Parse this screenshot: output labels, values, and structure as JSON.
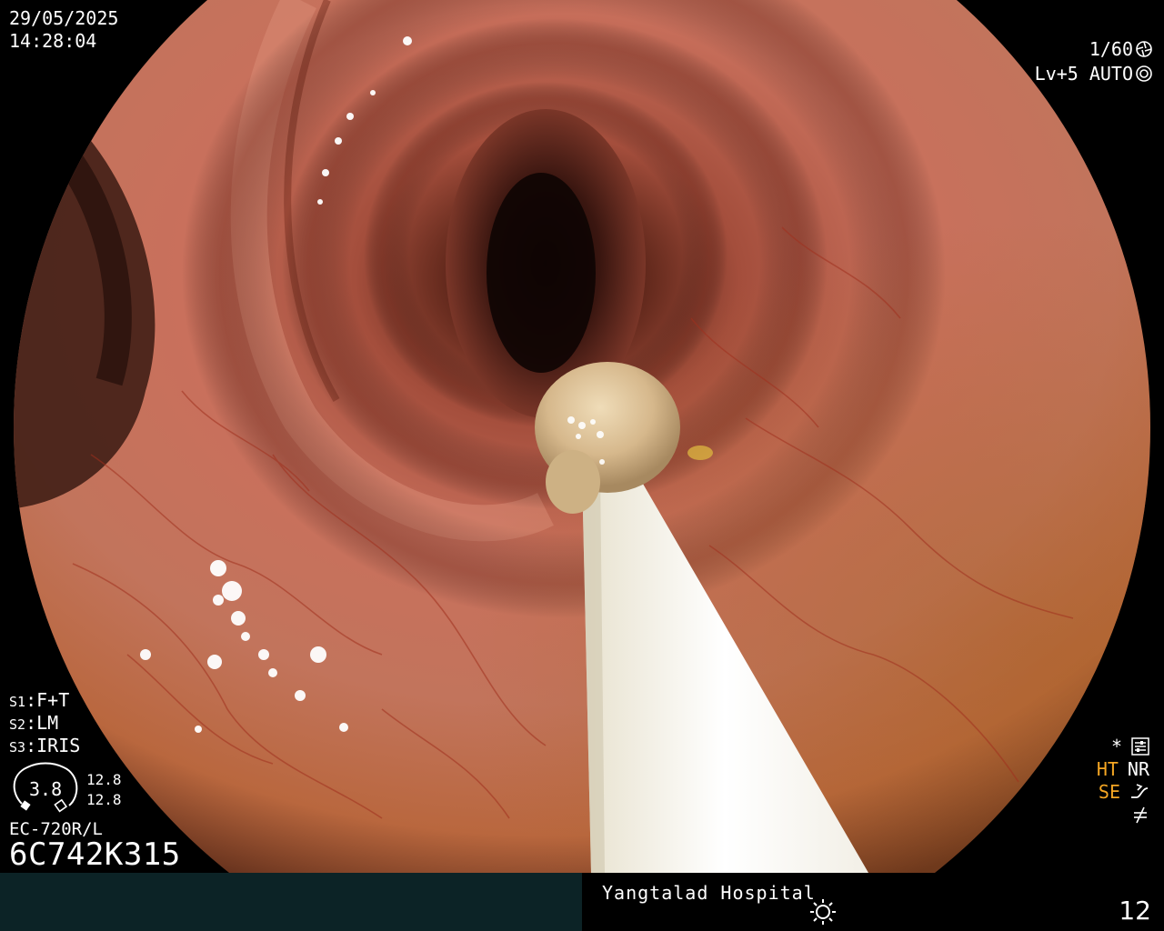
{
  "header": {
    "date": "29/05/2025",
    "time": "14:28:04",
    "shutter_speed": "1/60",
    "shutter_icon": "aperture-icon",
    "light_level": "Lv+5",
    "exposure_mode": "AUTO",
    "exposure_icon": "camera-lens-icon"
  },
  "settings": [
    {
      "key": "S1",
      "sep": ":",
      "value": "F+T"
    },
    {
      "key": "S2",
      "sep": ":",
      "value": "LM"
    },
    {
      "key": "S3",
      "sep": ":",
      "value": "IRIS"
    }
  ],
  "lens": {
    "center_value": "3.8",
    "value_top": "12.8",
    "value_bottom": "12.8"
  },
  "scope": {
    "model": "EC-720R/L",
    "serial": "6C742K315"
  },
  "status_right": {
    "asterisk": "*",
    "menu_icon": "settings-panel-icon",
    "ht": "HT",
    "nr": "NR",
    "se": "SE",
    "se_icon": "curve-arrow-icon",
    "filter_icon": "not-equal-icon"
  },
  "footer": {
    "hospital": "Yangtalad Hospital",
    "brightness_icon": "sun-icon",
    "image_count": "12"
  },
  "colors": {
    "highlight": "#f5a623",
    "footer_bg": "#0c2326",
    "text": "#ffffff"
  }
}
